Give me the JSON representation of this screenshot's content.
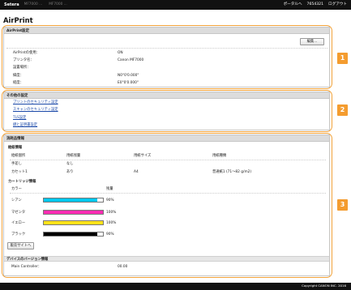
{
  "topbar": {
    "brand": "Setera",
    "crumb1": "MF7000 ...",
    "crumb2": "MF7000 ...",
    "portal_link": "ポータルへ",
    "user_id": "7654321",
    "logout": "ログアウト"
  },
  "page_title": "AirPrint",
  "airprint": {
    "header": "AirPrint設定",
    "edit_button": "編集...",
    "rows": [
      {
        "label": "AirPrintの使用：",
        "value": "ON"
      },
      {
        "label": "プリンタ名：",
        "value": "Canon MF7000"
      },
      {
        "label": "設置場所：",
        "value": ""
      },
      {
        "label": "緯度：",
        "value": "N0°0'0.000\""
      },
      {
        "label": "経度：",
        "value": "E0°0'0.000\""
      }
    ]
  },
  "other": {
    "header": "その他の設定",
    "links": [
      "プリントのセキュリティ設定",
      "スキャンのセキュリティ設定",
      "TLS設定",
      "鍵と証明書設定"
    ]
  },
  "consumables": {
    "header": "消耗品情報",
    "paper": {
      "subheader": "給紙情報",
      "columns": [
        "給紙個所",
        "用紙残量",
        "用紙サイズ",
        "用紙種類"
      ],
      "rows": [
        [
          "手差し",
          "なし",
          "",
          ""
        ],
        [
          "カセット1",
          "あり",
          "A4",
          "普通紙1 (71～82 g/m2)"
        ]
      ]
    },
    "cartridge": {
      "subheader": "カートリッジ情報",
      "col_color": "カラー",
      "col_level": "残量",
      "items": [
        {
          "name": "シアン",
          "color": "#00c8ee",
          "level": 90,
          "label": "90%"
        },
        {
          "name": "マゼンタ",
          "color": "#ff2cb3",
          "level": 100,
          "label": "100%"
        },
        {
          "name": "イエロー",
          "color": "#ffe21a",
          "level": 100,
          "label": "100%"
        },
        {
          "name": "ブラック",
          "color": "#000000",
          "level": 90,
          "label": "90%"
        }
      ]
    },
    "sales_button": "販売サイトへ",
    "version": {
      "subheader": "デバイスのバージョン情報",
      "label": "Main Controller：",
      "value": "00.00"
    }
  },
  "badges": [
    "1",
    "2",
    "3"
  ],
  "footer": "Copyright CANON INC. 2016"
}
